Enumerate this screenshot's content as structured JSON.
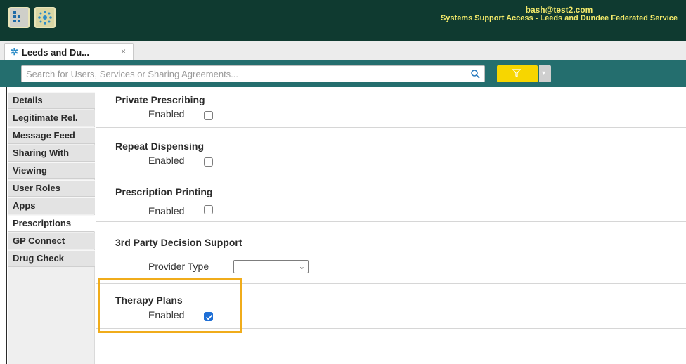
{
  "header": {
    "email": "bash@test2.com",
    "access": "Systems Support Access - Leeds and Dundee Federated Service"
  },
  "tabs": [
    {
      "label": "Leeds and Du...",
      "close": "×"
    }
  ],
  "search": {
    "placeholder": "Search for Users, Services or Sharing Agreements..."
  },
  "sidebar": {
    "items": [
      {
        "label": "Details"
      },
      {
        "label": "Legitimate Rel."
      },
      {
        "label": "Message Feed"
      },
      {
        "label": "Sharing With"
      },
      {
        "label": "Viewing"
      },
      {
        "label": "User Roles"
      },
      {
        "label": "Apps"
      },
      {
        "label": "Prescriptions",
        "active": true
      },
      {
        "label": "GP Connect"
      },
      {
        "label": "Drug Check"
      }
    ]
  },
  "settings": [
    {
      "title": "Private Prescribing",
      "field_label": "Enabled",
      "checked": false
    },
    {
      "title": "Repeat Dispensing",
      "field_label": "Enabled",
      "checked": false
    },
    {
      "title": "Prescription Printing",
      "field_label": "Enabled",
      "checked": false
    },
    {
      "title": "3rd Party Decision Support",
      "field_label": "Provider Type",
      "select_value": ""
    },
    {
      "title": "Therapy Plans",
      "field_label": "Enabled",
      "checked": true
    }
  ],
  "colors": {
    "topbar": "#0f3a30",
    "searchbar": "#246e6e",
    "filter": "#f7d600",
    "highlight": "#f0ac1b",
    "checkbox_checked": "#1f6fd6"
  }
}
